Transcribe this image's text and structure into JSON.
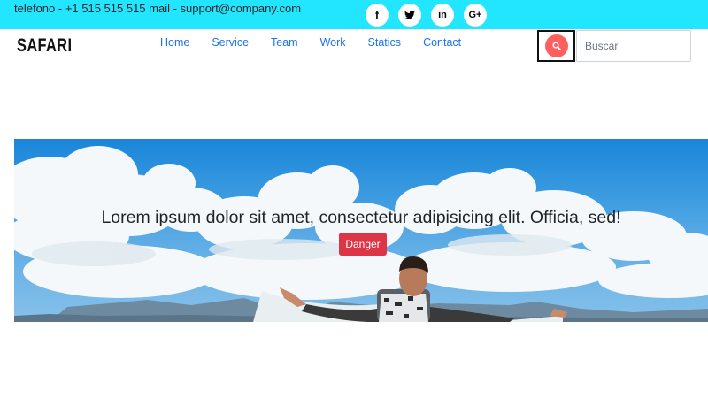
{
  "topbar": {
    "contact_text": "telefono - +1 515 515 515 mail - support@company.com",
    "socials": [
      {
        "icon": "facebook-icon",
        "glyph": "f"
      },
      {
        "icon": "twitter-icon",
        "glyph": ""
      },
      {
        "icon": "linkedin-icon",
        "glyph": "in"
      },
      {
        "icon": "google-plus-icon",
        "glyph": "G+"
      }
    ],
    "background_color": "#22e5ff"
  },
  "navbar": {
    "brand": "SAFARI",
    "links": [
      "Home",
      "Service",
      "Team",
      "Work",
      "Statics",
      "Contact"
    ],
    "link_color": "#1e73e8",
    "search": {
      "icon": "search-icon",
      "placeholder": "Buscar",
      "value": ""
    }
  },
  "hero": {
    "title": "Lorem ipsum dolor sit amet, consectetur adipisicing elit. Officia, sed!",
    "button_label": "Danger",
    "button_color": "#dc3545"
  }
}
